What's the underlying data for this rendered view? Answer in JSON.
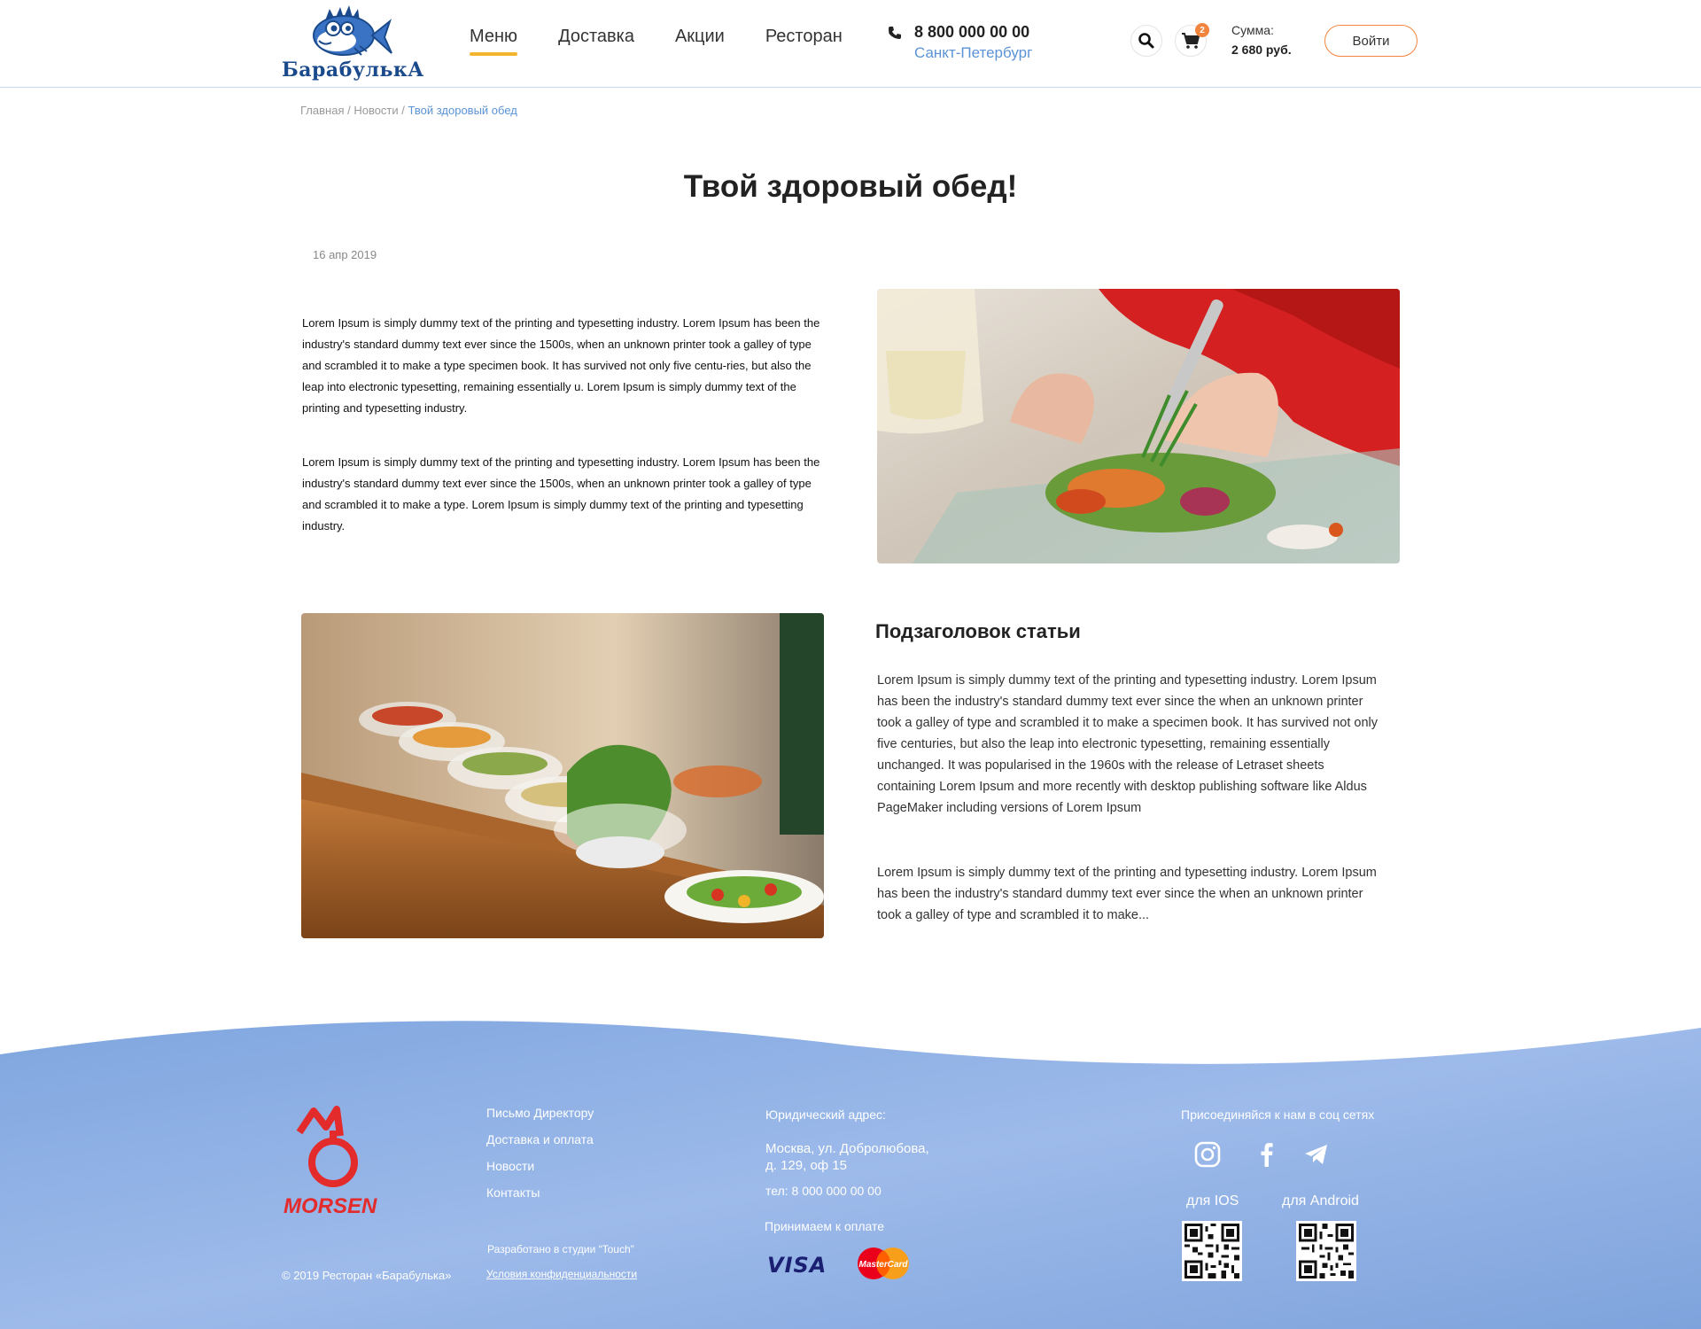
{
  "header": {
    "brand": "БарабулькА",
    "nav": [
      "Меню",
      "Доставка",
      "Акции",
      "Ресторан"
    ],
    "phone": "8 800 000 00 00",
    "city": "Санкт-Петербург",
    "cart_count": "2",
    "sum_label": "Сумма:",
    "sum_value": "2 680 руб.",
    "login": "Войти"
  },
  "breadcrumb": {
    "home": "Главная",
    "sep1": " / ",
    "news": "Новости",
    "sep2": " / ",
    "current": "Твой здоровый обед"
  },
  "article": {
    "title": "Твой здоровый обед!",
    "date": "16 апр 2019",
    "p1": "Lorem Ipsum is simply dummy text of the printing and typesetting industry. Lorem Ipsum has been the industry's standard dummy text ever since the 1500s, when an unknown printer took a galley of type and scrambled it to make a type specimen book. It has survived not only five centu-ries, but also the leap into electronic typesetting, remaining essentially u. Lorem Ipsum is simply dummy text of the printing and typesetting industry.",
    "p2": "Lorem Ipsum is simply dummy text of the printing and typesetting industry. Lorem Ipsum has been the industry's standard dummy text ever since the 1500s, when an unknown printer took a galley of type and scrambled it to make a type. Lorem Ipsum is simply dummy text of the printing and typesetting industry.",
    "subheading": "Подзаголовок статьи",
    "p3": "Lorem Ipsum is simply dummy text of the printing and typesetting industry. Lorem Ipsum has been the industry's standard dummy text ever since the when an unknown printer took a galley of type and scrambled it to make a specimen book. It has survived not only five centuries, but also the leap into electronic typesetting, remaining essentially unchanged. It was popularised in the 1960s with the release of Letraset sheets containing Lorem Ipsum and more recently with desktop publishing software like Aldus PageMaker including versions of Lorem Ipsum",
    "p4": "Lorem Ipsum is simply dummy text of the printing and typesetting industry. Lorem Ipsum has been the industry's standard dummy text ever since the when an unknown printer took a galley of type and scrambled it to make..."
  },
  "footer": {
    "logo_text": "MORSEN",
    "links": [
      "Письмо Директору",
      "Доставка и оплата",
      "Новости",
      "Контакты"
    ],
    "studio": "Разработано в студии “Touch”",
    "privacy": "Условия конфиденциальности",
    "copyright": "© 2019 Ресторан «Барабулька»",
    "legal_title": "Юридический адрес:",
    "legal_addr_1": "Москва, ул. Добролюбова,",
    "legal_addr_2": "д. 129, оф 15",
    "legal_tel": "тел: 8 000 000 00 00",
    "pay_title": "Принимаем к оплате",
    "visa": "VISA",
    "mastercard": "MasterCard",
    "social_title": "Присоединяйся к нам в соц сетях",
    "app_ios": "для IOS",
    "app_android": "для Android"
  },
  "colors": {
    "accent_orange": "#f2843d",
    "nav_underline": "#f3b530",
    "link_blue": "#5b93d6",
    "footer_blue": "#8cb0e4",
    "brand_navy": "#1b4a8c",
    "morsen_red": "#e32b2b"
  },
  "icons": [
    "phone-icon",
    "search-icon",
    "cart-icon",
    "instagram-icon",
    "facebook-icon",
    "telegram-icon",
    "qr-code-icon",
    "fish-logo-icon"
  ]
}
